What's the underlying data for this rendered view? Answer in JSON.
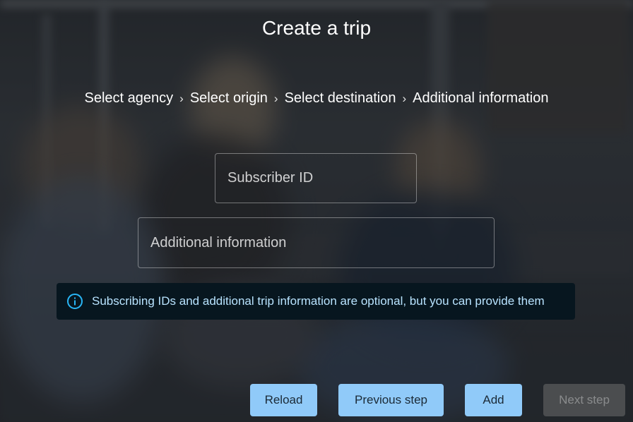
{
  "page": {
    "title": "Create a trip"
  },
  "breadcrumb": {
    "steps": [
      "Select agency",
      "Select origin",
      "Select destination",
      "Additional information"
    ],
    "separator": "›"
  },
  "form": {
    "subscriber_placeholder": "Subscriber ID",
    "additional_placeholder": "Additional information"
  },
  "alert": {
    "icon": "info-icon",
    "text": "Subscribing IDs and additional trip information are optional, but you can provide them"
  },
  "actions": {
    "reload_label": "Reload",
    "previous_label": "Previous step",
    "add_label": "Add",
    "next_label": "Next step",
    "next_disabled": true
  },
  "colors": {
    "button_primary": "#90caf9",
    "alert_background": "#07161f",
    "alert_text": "#b8e3ff",
    "alert_icon": "#29b6f6"
  }
}
